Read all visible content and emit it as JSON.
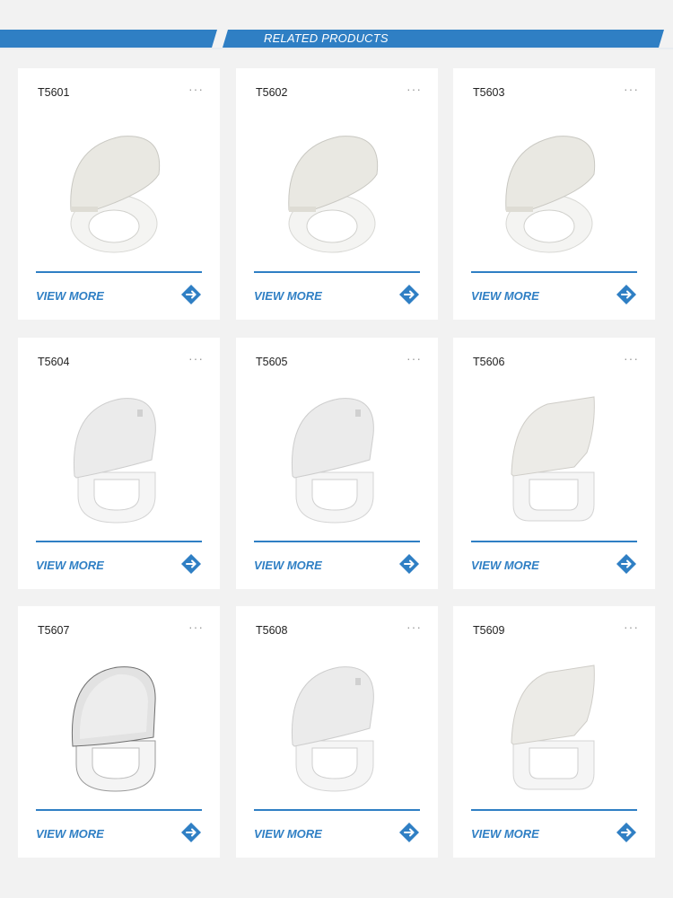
{
  "header": {
    "title": "RELATED PRODUCTS",
    "accent_color": "#2f7fc4"
  },
  "products": [
    {
      "code": "T5601",
      "variant": "round"
    },
    {
      "code": "T5602",
      "variant": "round"
    },
    {
      "code": "T5603",
      "variant": "round"
    },
    {
      "code": "T5604",
      "variant": "d-shape"
    },
    {
      "code": "T5605",
      "variant": "d-shape"
    },
    {
      "code": "T5606",
      "variant": "square"
    },
    {
      "code": "T5607",
      "variant": "d-shape-dark-edge"
    },
    {
      "code": "T5608",
      "variant": "d-shape"
    },
    {
      "code": "T5609",
      "variant": "square"
    }
  ],
  "labels": {
    "view_more": "VIEW MORE",
    "more_dots": "···"
  },
  "icons": {
    "more": "ellipsis-icon",
    "arrow": "arrow-right-circle-icon"
  }
}
